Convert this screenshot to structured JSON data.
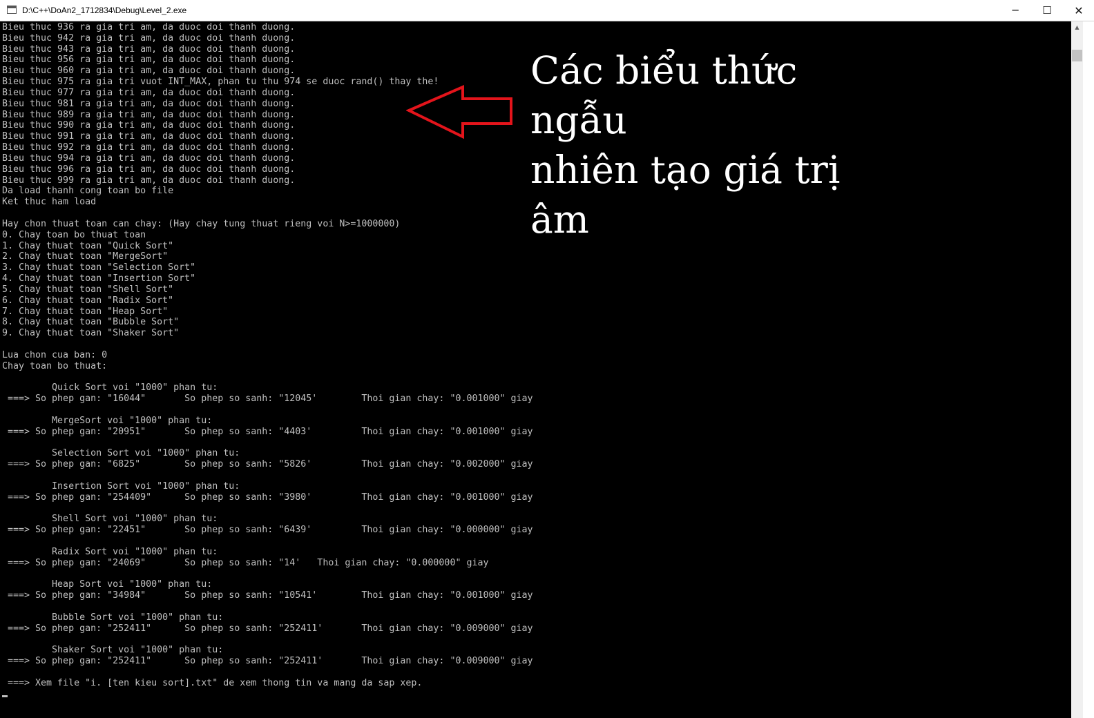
{
  "window": {
    "title": "D:\\C++\\DoAn2_1712834\\Debug\\Level_2.exe",
    "minimize_glyph": "─",
    "maximize_glyph": "☐",
    "close_glyph": "✕"
  },
  "console": {
    "lines": [
      "Bieu thuc 936 ra gia tri am, da duoc doi thanh duong.",
      "Bieu thuc 942 ra gia tri am, da duoc doi thanh duong.",
      "Bieu thuc 943 ra gia tri am, da duoc doi thanh duong.",
      "Bieu thuc 956 ra gia tri am, da duoc doi thanh duong.",
      "Bieu thuc 960 ra gia tri am, da duoc doi thanh duong.",
      "Bieu thuc 975 ra gia tri vuot INT_MAX, phan tu thu 974 se duoc rand() thay the!",
      "Bieu thuc 977 ra gia tri am, da duoc doi thanh duong.",
      "Bieu thuc 981 ra gia tri am, da duoc doi thanh duong.",
      "Bieu thuc 989 ra gia tri am, da duoc doi thanh duong.",
      "Bieu thuc 990 ra gia tri am, da duoc doi thanh duong.",
      "Bieu thuc 991 ra gia tri am, da duoc doi thanh duong.",
      "Bieu thuc 992 ra gia tri am, da duoc doi thanh duong.",
      "Bieu thuc 994 ra gia tri am, da duoc doi thanh duong.",
      "Bieu thuc 996 ra gia tri am, da duoc doi thanh duong.",
      "Bieu thuc 999 ra gia tri am, da duoc doi thanh duong.",
      "Da load thanh cong toan bo file",
      "Ket thuc ham load",
      "",
      "Hay chon thuat toan can chay: (Hay chay tung thuat rieng voi N>=1000000)",
      "0. Chay toan bo thuat toan",
      "1. Chay thuat toan \"Quick Sort\"",
      "2. Chay thuat toan \"MergeSort\"",
      "3. Chay thuat toan \"Selection Sort\"",
      "4. Chay thuat toan \"Insertion Sort\"",
      "5. Chay thuat toan \"Shell Sort\"",
      "6. Chay thuat toan \"Radix Sort\"",
      "7. Chay thuat toan \"Heap Sort\"",
      "8. Chay thuat toan \"Bubble Sort\"",
      "9. Chay thuat toan \"Shaker Sort\"",
      "",
      "Lua chon cua ban: 0",
      "Chay toan bo thuat:",
      "",
      "         Quick Sort voi \"1000\" phan tu:",
      " ===> So phep gan: \"16044\"       So phep so sanh: \"12045'        Thoi gian chay: \"0.001000\" giay",
      "",
      "         MergeSort voi \"1000\" phan tu:",
      " ===> So phep gan: \"20951\"       So phep so sanh: \"4403'         Thoi gian chay: \"0.001000\" giay",
      "",
      "         Selection Sort voi \"1000\" phan tu:",
      " ===> So phep gan: \"6825\"        So phep so sanh: \"5826'         Thoi gian chay: \"0.002000\" giay",
      "",
      "         Insertion Sort voi \"1000\" phan tu:",
      " ===> So phep gan: \"254409\"      So phep so sanh: \"3980'         Thoi gian chay: \"0.001000\" giay",
      "",
      "         Shell Sort voi \"1000\" phan tu:",
      " ===> So phep gan: \"22451\"       So phep so sanh: \"6439'         Thoi gian chay: \"0.000000\" giay",
      "",
      "         Radix Sort voi \"1000\" phan tu:",
      " ===> So phep gan: \"24069\"       So phep so sanh: \"14'   Thoi gian chay: \"0.000000\" giay",
      "",
      "         Heap Sort voi \"1000\" phan tu:",
      " ===> So phep gan: \"34984\"       So phep so sanh: \"10541'        Thoi gian chay: \"0.001000\" giay",
      "",
      "         Bubble Sort voi \"1000\" phan tu:",
      " ===> So phep gan: \"252411\"      So phep so sanh: \"252411'       Thoi gian chay: \"0.009000\" giay",
      "",
      "         Shaker Sort voi \"1000\" phan tu:",
      " ===> So phep gan: \"252411\"      So phep so sanh: \"252411'       Thoi gian chay: \"0.009000\" giay",
      "",
      " ===> Xem file \"i. [ten kieu sort].txt\" de xem thong tin va mang da sap xep."
    ]
  },
  "annotation": {
    "line1": "Các biểu thức ngẫu",
    "line2": "nhiên tạo giá trị âm",
    "arrow_color": "#e3141b"
  }
}
